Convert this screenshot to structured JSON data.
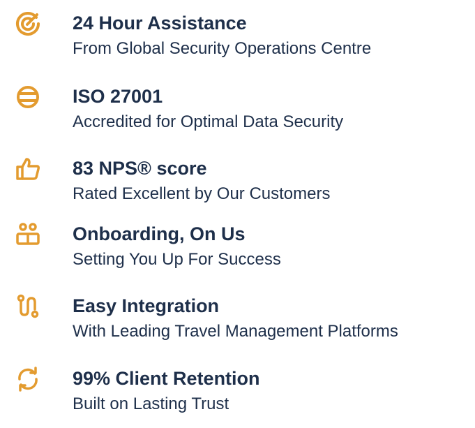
{
  "accent_color": "#E39B2F",
  "text_color": "#1E2F4A",
  "features": [
    {
      "icon": "target-icon",
      "title": "24 Hour Assistance",
      "subtitle": "From Global Security Operations Centre"
    },
    {
      "icon": "globe-icon",
      "title": "ISO 27001",
      "subtitle": "Accredited for Optimal Data Security"
    },
    {
      "icon": "thumbs-up-icon",
      "title": "83 NPS® score",
      "subtitle": "Rated Excellent by Our Customers"
    },
    {
      "icon": "people-icon",
      "title": "Onboarding, On Us",
      "subtitle": "Setting You Up For Success"
    },
    {
      "icon": "route-icon",
      "title": "Easy Integration",
      "subtitle": "With Leading Travel Management Platforms"
    },
    {
      "icon": "refresh-icon",
      "title": "99% Client Retention",
      "subtitle": "Built on Lasting Trust"
    }
  ]
}
